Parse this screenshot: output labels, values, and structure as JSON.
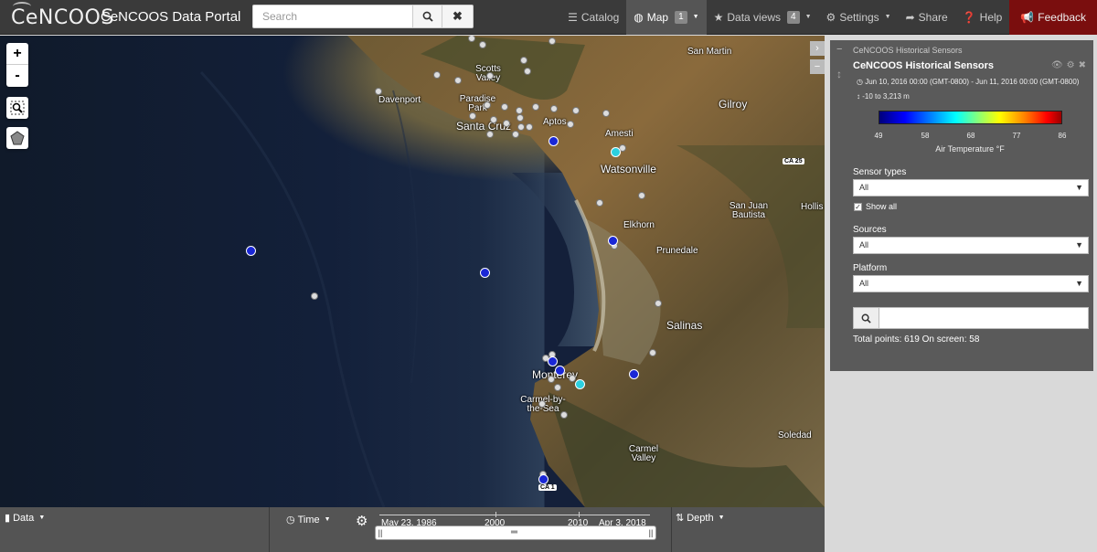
{
  "navbar": {
    "logo_text": "CeNCOOS",
    "portal_title": "CeNCOOS Data Portal",
    "search_placeholder": "Search",
    "items": {
      "catalog": "Catalog",
      "map": "Map",
      "map_badge": "1",
      "data_views": "Data views",
      "data_views_badge": "4",
      "settings": "Settings",
      "share": "Share",
      "help": "Help",
      "feedback": "Feedback"
    }
  },
  "map": {
    "zoom_in": "+",
    "zoom_out": "-",
    "places": {
      "davenport": "Davenport",
      "scotts_valley": "Scotts Valley",
      "paradise_park": "Paradise Park",
      "santa_cruz": "Santa Cruz",
      "aptos": "Aptos",
      "san_martin": "San Martin",
      "gilroy": "Gilroy",
      "amesti": "Amesti",
      "watsonville": "Watsonville",
      "ca25": "CA 25",
      "hollis": "Hollis",
      "san_juan_bautista": "San Juan Bautista",
      "elkhorn": "Elkhorn",
      "prunedale": "Prunedale",
      "salinas": "Salinas",
      "monterey": "Monterey",
      "carmel_by_the_sea": "Carmel-by-the-Sea",
      "carmel_valley": "Carmel Valley",
      "ca1": "CA 1",
      "soledad": "Soledad"
    }
  },
  "panel": {
    "header": "CeNCOOS Historical Sensors",
    "title": "CeNCOOS Historical Sensors",
    "time_range": "Jun 10, 2016 00:00 (GMT-0800) - Jun 11, 2016 00:00 (GMT-0800)",
    "depth_range": "-10 to 3,213 m",
    "colorbar": {
      "ticks": [
        "49",
        "58",
        "68",
        "77",
        "86"
      ],
      "label": "Air Temperature °F"
    },
    "sensor_types_label": "Sensor types",
    "sensor_types_value": "All",
    "show_all_label": "Show all",
    "sources_label": "Sources",
    "sources_value": "All",
    "platform_label": "Platform",
    "platform_value": "All",
    "totals": "Total points: 619 On screen: 58"
  },
  "bottombar": {
    "data": "Data",
    "time": "Time",
    "depth": "Depth",
    "timeline": {
      "start": "May 23, 1986",
      "mid1": "2000",
      "mid2": "2010",
      "end": "Apr 3, 2018"
    }
  },
  "colors": {
    "navbar_bg": "#3a3a3a",
    "feedback_bg": "#7a0e0e",
    "panel_bg": "#5a5a5a",
    "point_blue": "#1a27d6",
    "point_cyan": "#2cd0e0"
  }
}
